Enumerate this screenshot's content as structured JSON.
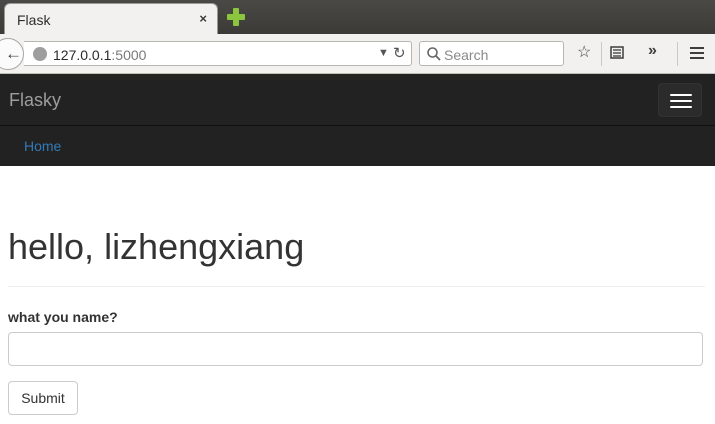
{
  "browser": {
    "tab_title": "Flask",
    "tab_close": "×",
    "url_host": "127.0.0.1",
    "url_port": ":5000",
    "search_placeholder": "Search",
    "icons": {
      "back": "back-arrow-icon",
      "site": "globe-icon",
      "dropdown": "chevron-down-icon",
      "reload": "reload-icon",
      "search": "search-icon",
      "bookmark": "star-icon",
      "reader": "reading-list-icon",
      "overflow": "chevron-double-right-icon",
      "menu": "hamburger-menu-icon",
      "new_tab": "plus-icon"
    },
    "new_tab_color": "#8cc63f"
  },
  "site": {
    "brand": "Flasky",
    "nav": {
      "home": "Home"
    },
    "colors": {
      "navbar_bg": "#222222",
      "link": "#337ab7"
    }
  },
  "main": {
    "heading": "hello, lizhengxiang",
    "form": {
      "name_label": "what you name?",
      "name_value": "",
      "submit_label": "Submit"
    }
  }
}
